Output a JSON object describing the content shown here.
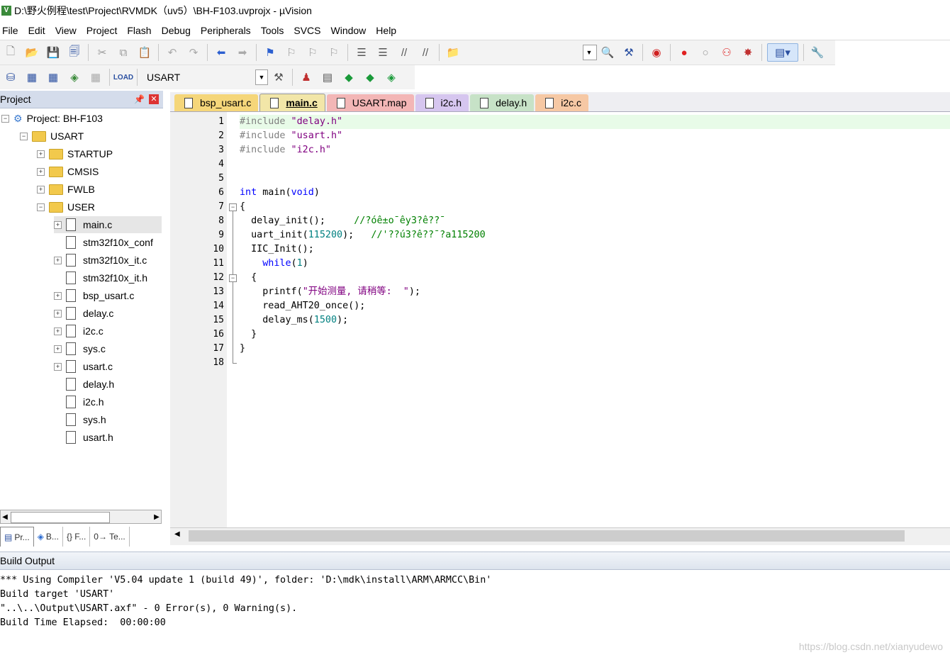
{
  "window": {
    "title": "D:\\野火例程\\test\\Project\\RVMDK（uv5）\\BH-F103.uvprojx - µVision",
    "app_icon": "keil-uvision-icon"
  },
  "menu": [
    "File",
    "Edit",
    "View",
    "Project",
    "Flash",
    "Debug",
    "Peripherals",
    "Tools",
    "SVCS",
    "Window",
    "Help"
  ],
  "toolbar": {
    "target": "USART"
  },
  "project_panel": {
    "title": "Project",
    "root": "Project: BH-F103",
    "target": "USART",
    "groups": [
      "STARTUP",
      "CMSIS",
      "FWLB",
      "USER"
    ],
    "files": [
      "main.c",
      "stm32f10x_conf",
      "stm32f10x_it.c",
      "stm32f10x_it.h",
      "bsp_usart.c",
      "delay.c",
      "i2c.c",
      "sys.c",
      "usart.c",
      "delay.h",
      "i2c.h",
      "sys.h",
      "usart.h"
    ],
    "bottom_tabs": [
      "Pr...",
      "B...",
      "{} F...",
      "0→ Te..."
    ]
  },
  "editor": {
    "tabs": [
      {
        "label": "bsp_usart.c",
        "color": "#f5d67a"
      },
      {
        "label": "main.c",
        "color": "#f2e6a8"
      },
      {
        "label": "USART.map",
        "color": "#f3b6b6"
      },
      {
        "label": "i2c.h",
        "color": "#d6c6ef"
      },
      {
        "label": "delay.h",
        "color": "#c7e2c7"
      },
      {
        "label": "i2c.c",
        "color": "#f6c8a4"
      }
    ],
    "active_tab": "main.c",
    "lines": [
      "1",
      "2",
      "3",
      "4",
      "5",
      "6",
      "7",
      "8",
      "9",
      "10",
      "11",
      "12",
      "13",
      "14",
      "15",
      "16",
      "17",
      "18"
    ],
    "code": {
      "l1a": "#include",
      "l1b": " \"delay.h\"",
      "l2a": "#include",
      "l2b": " \"usart.h\"",
      "l3a": "#include",
      "l3b": " \"i2c.h\"",
      "l6a": "int",
      "l6b": " main",
      "l6c": "(",
      "l6d": "void",
      "l6e": ")",
      "l7": "{",
      "l8a": "  delay_init();",
      "l8b": "     //?óê±o¯êy3?ê??¯",
      "l9a": "  uart_init(",
      "l9b": "115200",
      "l9c": ");",
      "l9d": "   //'??ú3?ê??¯?a115200",
      "l10": "  IIC_Init();",
      "l11a": "    while",
      "l11b": "(",
      "l11c": "1",
      "l11d": ")",
      "l12": "  {",
      "l13a": "    printf(",
      "l13b": "\"开始测量, 请稍等:  \"",
      "l13c": ");",
      "l14": "    read_AHT20_once();",
      "l15a": "    delay_ms(",
      "l15b": "1500",
      "l15c": ");",
      "l16": "  }",
      "l17": "}"
    }
  },
  "build_output": {
    "title": "Build Output",
    "lines": [
      "*** Using Compiler 'V5.04 update 1 (build 49)', folder: 'D:\\mdk\\install\\ARM\\ARMCC\\Bin'",
      "Build target 'USART'",
      "\"..\\..\\Output\\USART.axf\" - 0 Error(s), 0 Warning(s).",
      "Build Time Elapsed:  00:00:00"
    ]
  },
  "watermark": "https://blog.csdn.net/xianyudewo"
}
